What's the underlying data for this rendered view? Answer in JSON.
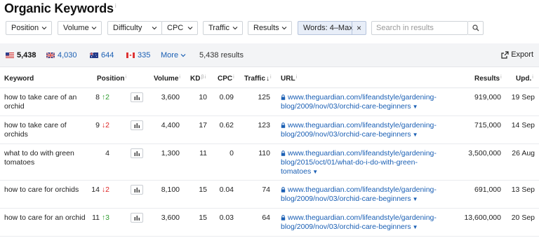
{
  "header": {
    "title": "Organic Keywords",
    "info": "i"
  },
  "filters": {
    "position": "Position",
    "volume": "Volume",
    "difficulty": "Difficulty",
    "cpc": "CPC",
    "traffic": "Traffic",
    "results": "Results",
    "words": "Words: 4–Max",
    "words_clear": "×",
    "search_placeholder": "Search in results"
  },
  "stats": {
    "us": "5,438",
    "gb": "4,030",
    "au": "644",
    "ca": "335",
    "more": "More",
    "total": "5,438 results",
    "export": "Export"
  },
  "columns": {
    "keyword": "Keyword",
    "position": "Position",
    "volume": "Volume",
    "kd": "KD",
    "cpc": "CPC",
    "traffic": "Traffic",
    "url": "URL",
    "results": "Results",
    "updated": "Upd."
  },
  "rows": [
    {
      "keyword": "how to take care of an orchid",
      "position": "8",
      "change": "2",
      "direction": "up",
      "volume": "3,600",
      "kd": "10",
      "cpc": "0.09",
      "traffic": "125",
      "url": "www.theguardian.com/lifeandstyle/gardening-blog/2009/nov/03/orchid-care-beginners",
      "results": "919,000",
      "updated": "19 Sep"
    },
    {
      "keyword": "how to take care of orchids",
      "position": "9",
      "change": "2",
      "direction": "down",
      "volume": "4,400",
      "kd": "17",
      "cpc": "0.62",
      "traffic": "123",
      "url": "www.theguardian.com/lifeandstyle/gardening-blog/2009/nov/03/orchid-care-beginners",
      "results": "715,000",
      "updated": "14 Sep"
    },
    {
      "keyword": "what to do with green tomatoes",
      "position": "4",
      "change": "",
      "direction": "",
      "volume": "1,300",
      "kd": "11",
      "cpc": "0",
      "traffic": "110",
      "url": "www.theguardian.com/lifeandstyle/gardening-blog/2015/oct/01/what-do-i-do-with-green-tomatoes",
      "results": "3,500,000",
      "updated": "26 Aug"
    },
    {
      "keyword": "how to care for orchids",
      "position": "14",
      "change": "2",
      "direction": "down",
      "volume": "8,100",
      "kd": "15",
      "cpc": "0.04",
      "traffic": "74",
      "url": "www.theguardian.com/lifeandstyle/gardening-blog/2009/nov/03/orchid-care-beginners",
      "results": "691,000",
      "updated": "13 Sep"
    },
    {
      "keyword": "how to care for an orchid",
      "position": "11",
      "change": "3",
      "direction": "up",
      "volume": "3,600",
      "kd": "15",
      "cpc": "0.03",
      "traffic": "64",
      "url": "www.theguardian.com/lifeandstyle/gardening-blog/2009/nov/03/orchid-care-beginners",
      "results": "13,600,000",
      "updated": "20 Sep"
    }
  ],
  "colors": {
    "link": "#1a5fb4",
    "up": "#2e9b2e",
    "down": "#dd2222"
  }
}
